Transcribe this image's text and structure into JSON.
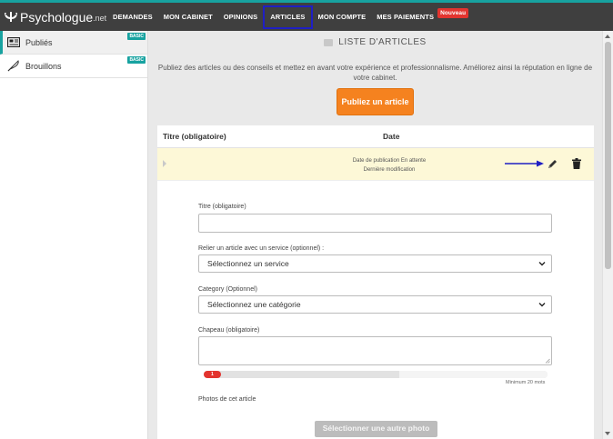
{
  "brand": {
    "name": "Psychologue",
    "suffix": ".net"
  },
  "nav": {
    "items": [
      {
        "label": "DEMANDES"
      },
      {
        "label": "MON CABINET"
      },
      {
        "label": "OPINIONS"
      },
      {
        "label": "ARTICLES"
      },
      {
        "label": "MON COMPTE"
      },
      {
        "label": "MES PAIEMENTS"
      }
    ],
    "new_badge": "Nouveau"
  },
  "sidebar": {
    "items": [
      {
        "label": "Publiés",
        "badge": "BASIC",
        "icon": "newspaper-icon"
      },
      {
        "label": "Brouillons",
        "badge": "BASIC",
        "icon": "quill-icon"
      }
    ]
  },
  "main": {
    "title": "LISTE D'ARTICLES",
    "intro": "Publiez des articles ou des conseils et mettez en avant votre expérience et professionnalisme. Améliorez ainsi la réputation en ligne de votre cabinet.",
    "publish_button": "Publiez un article",
    "table": {
      "headers": [
        "Titre (obligatoire)",
        "Date"
      ],
      "row": {
        "date_publication": "Date de publication En attente",
        "last_modified": "Dernière modification"
      }
    },
    "form": {
      "title_label": "Titre (obligatoire)",
      "title_value": "",
      "service_label": "Relier un article avec un service (optionnel) :",
      "service_selected": "Sélectionnez un service",
      "category_label": "Category (Optionnel)",
      "category_selected": "Sélectionnez une catégorie",
      "chapeau_label": "Chapeau (obligatoire)",
      "chapeau_value": "",
      "progress_count": "1",
      "progress_fraction": 0.05,
      "minimum_words": "Minimum 20 mots",
      "photos_label": "Photos de cet article",
      "photo_button": "Sélectionner une autre photo"
    }
  },
  "colors": {
    "accent": "#17a2a0",
    "cta": "#f5821f",
    "badge_new": "#e3342f",
    "highlight_row": "#fdf8d7",
    "active_nav_border": "#1f1fc4"
  }
}
